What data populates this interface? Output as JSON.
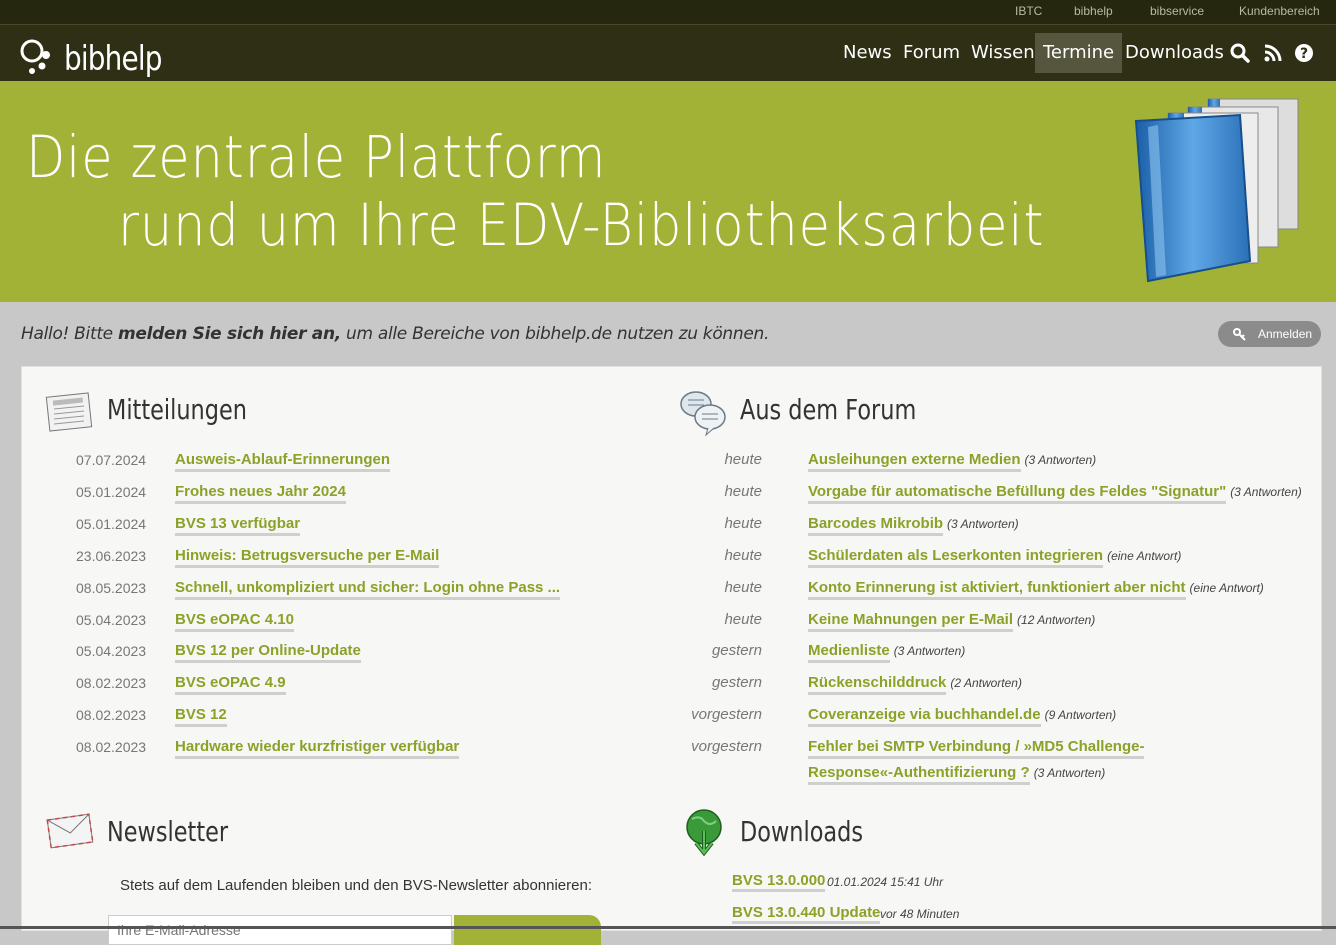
{
  "topbar": {
    "links": [
      "IBTC",
      "bibhelp",
      "bibservice",
      "Kundenbereich"
    ]
  },
  "brand": {
    "name": "bibhelp"
  },
  "nav": {
    "items": [
      "News",
      "Forum",
      "Wissen",
      "Termine",
      "Downloads"
    ],
    "active": "Termine",
    "icons": [
      "search-icon",
      "rss-icon",
      "help-icon"
    ]
  },
  "banner": {
    "line1": "Die zentrale Plattform",
    "line2": "rund um Ihre EDV-Bibliotheksarbeit"
  },
  "login": {
    "hello_prefix": "Hallo! Bitte ",
    "hello_bold": "melden Sie sich hier an,",
    "hello_suffix": " um alle Bereiche von bibhelp.de nutzen zu können.",
    "button": "Anmelden"
  },
  "mitteilungen": {
    "title": "Mitteilungen",
    "items": [
      {
        "date": "07.07.2024",
        "title": "Ausweis-Ablauf-Erinnerungen"
      },
      {
        "date": "05.01.2024",
        "title": "Frohes neues Jahr 2024"
      },
      {
        "date": "05.01.2024",
        "title": "BVS 13 verfügbar"
      },
      {
        "date": "23.06.2023",
        "title": "Hinweis: Betrugsversuche per E-Mail"
      },
      {
        "date": "08.05.2023",
        "title": "Schnell, unkompliziert und sicher: Login ohne Pass ..."
      },
      {
        "date": "05.04.2023",
        "title": "BVS eOPAC 4.10"
      },
      {
        "date": "05.04.2023",
        "title": "BVS 12 per Online-Update"
      },
      {
        "date": "08.02.2023",
        "title": "BVS eOPAC 4.9"
      },
      {
        "date": "08.02.2023",
        "title": "BVS 12"
      },
      {
        "date": "08.02.2023",
        "title": "Hardware wieder kurzfristiger verfügbar"
      }
    ]
  },
  "forum": {
    "title": "Aus dem Forum",
    "items": [
      {
        "when": "heute",
        "title": "Ausleihungen externe Medien",
        "answers": "(3 Antworten)"
      },
      {
        "when": "heute",
        "title": "Vorgabe für automatische Befüllung des Feldes \"Signatur\"",
        "answers": "(3 Antworten)"
      },
      {
        "when": "heute",
        "title": "Barcodes Mikrobib",
        "answers": "(3 Antworten)"
      },
      {
        "when": "heute",
        "title": "Schülerdaten als Leserkonten integrieren",
        "answers": "(eine Antwort)"
      },
      {
        "when": "heute",
        "title": "Konto Erinnerung ist aktiviert, funktioniert aber nicht",
        "answers": "(eine Antwort)"
      },
      {
        "when": "heute",
        "title": "Keine Mahnungen per E-Mail",
        "answers": "(12 Antworten)"
      },
      {
        "when": "gestern",
        "title": "Medienliste",
        "answers": "(3 Antworten)"
      },
      {
        "when": "gestern",
        "title": "Rückenschilddruck",
        "answers": "(2 Antworten)"
      },
      {
        "when": "vorgestern",
        "title": "Coveranzeige via buchhandel.de",
        "answers": "(9 Antworten)"
      },
      {
        "when": "vorgestern",
        "title": "Fehler bei SMTP Verbindung / »MD5 Challenge-",
        "title2": "Response«-Authentifizierung ?",
        "answers": "(3 Antworten)"
      }
    ]
  },
  "newsletter": {
    "title": "Newsletter",
    "text": "Stets auf dem Laufenden bleiben und den BVS-Newsletter abonnieren:",
    "input_placeholder": "Ihre E-Mail-Adresse"
  },
  "downloads": {
    "title": "Downloads",
    "items": [
      {
        "title": "BVS 13.0.000",
        "meta": "01.01.2024 15:41 Uhr"
      },
      {
        "title": "BVS 13.0.440 Update",
        "meta": "vor 48 Minuten"
      }
    ]
  },
  "colors": {
    "accent": "#a1b236",
    "link": "#8aa228",
    "navbar": "#2e2f14",
    "topbar": "#26270f"
  }
}
